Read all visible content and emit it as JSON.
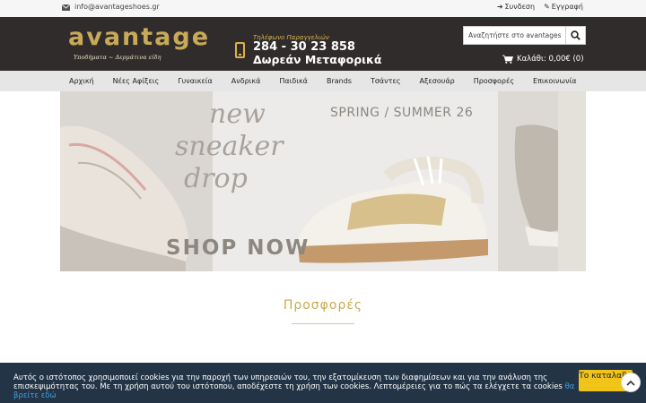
{
  "topbar": {
    "email": "info@avantageshoes.gr",
    "login_label": "Συνδεση",
    "register_label": "Εγγραφή"
  },
  "header": {
    "logo_text": "avantage",
    "logo_tagline": "Υποδήματα ~ Δερμάτινα είδη",
    "phone_label": "Τηλέφωνο Παραγγελιών",
    "phone_number": "284 - 30 23 858",
    "free_shipping": "Δωρεάν Μεταφορικά",
    "search_placeholder": "Αναζητήστε στο avantageshoes",
    "cart_text": "Καλάθι: 0,00€ (0)"
  },
  "nav": {
    "items": [
      "Αρχική",
      "Νέες Αφίξεις",
      "Γυναικεία",
      "Ανδρικά",
      "Παιδικά",
      "Brands",
      "Τσάντες",
      "Αξεσουάρ",
      "Προσφορές",
      "Επικοινωνία"
    ]
  },
  "banner": {
    "headline_1": "new",
    "headline_2": "sneaker",
    "headline_3": "drop",
    "season": "SPRING / SUMMER 26",
    "cta": "SHOP NOW"
  },
  "section": {
    "title": "Προσφορές"
  },
  "cookie": {
    "text": "Αυτός ο ιστότοπος χρησιμοποιεί cookies για την παροχή των υπηρεσιών του, την εξατομίκευση των διαφημίσεων και για την ανάλυση της επισκεψιμότητας του. Με τη χρήση αυτού του ιστότοπου, αποδέχεστε τη χρήση των cookies. Λεπτομέρειες για το πώς τα ελέγχετε τα cookies",
    "more_link": "θα βρείτε εδώ",
    "accept_label": "Το καταλαβα"
  },
  "colors": {
    "header_bg": "#302c2b",
    "gold": "#c8a95a",
    "nav_bg": "#e6e6e6",
    "cookie_bg": "#233447",
    "accept_bg": "#f0c419"
  },
  "icons": {
    "email": "envelope-icon",
    "login": "sign-in-icon",
    "register": "edit-icon",
    "phone": "mobile-phone-icon",
    "search": "search-icon",
    "cart": "shopping-cart-icon",
    "scroll_top": "chevron-up-icon"
  }
}
